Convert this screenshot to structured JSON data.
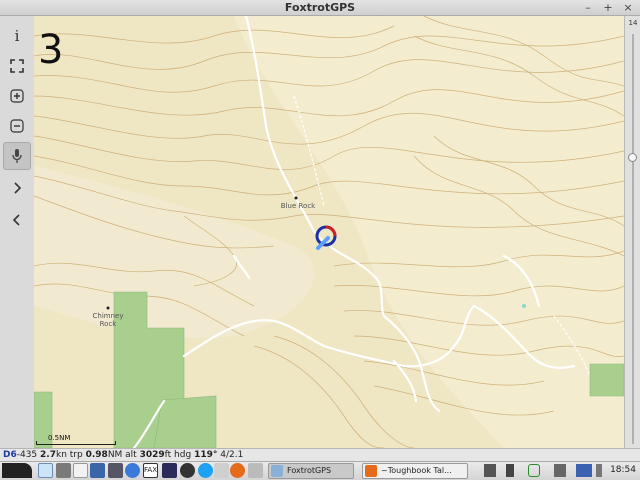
{
  "window": {
    "title": "FoxtrotGPS"
  },
  "toolbar": {
    "info_label": "i"
  },
  "map": {
    "zoom_overlay": "3",
    "labels": {
      "blue_rock": "Blue Rock",
      "chimney_rock": "Chimney Rock"
    },
    "scale_label": "0.5NM"
  },
  "zoom_slider": {
    "level": "14",
    "position_fraction": 0.3
  },
  "status": {
    "tag": "D6",
    "sep": "-435",
    "speed": "2.7",
    "speed_unit": "kn trp",
    "trip": "0.98",
    "trip_unit": "NM alt",
    "alt": "3029",
    "alt_unit": "ft hdg",
    "hdg": "119°",
    "sats": "4/2.1"
  },
  "taskbar": {
    "tasks": [
      {
        "label": "FoxtrotGPS",
        "active": true
      },
      {
        "label": "~Toughbook Tal...",
        "active": false
      }
    ],
    "clock": "18:54",
    "colors": {
      "accent": "#1a3aa0",
      "map_bg": "#efe6c4",
      "forest": "#a9cf8f",
      "contour": "#c9a66b"
    }
  }
}
